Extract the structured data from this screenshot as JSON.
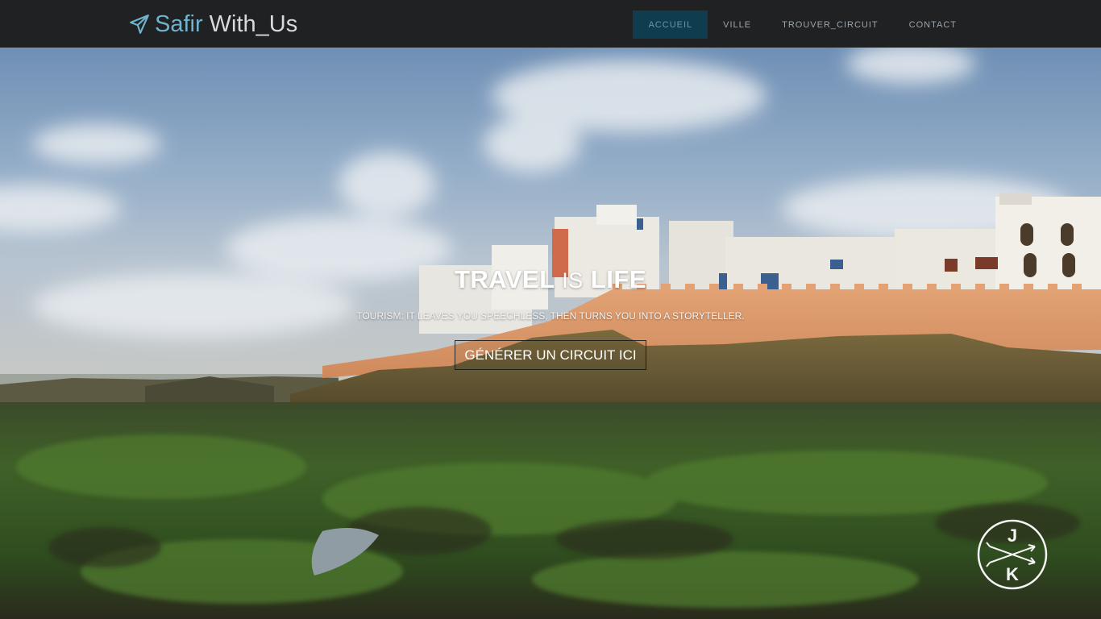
{
  "brand": {
    "word1": "Safir",
    "word2": "With_Us",
    "icon": "paper-plane-icon"
  },
  "nav": [
    {
      "label": "ACCUEIL",
      "active": true
    },
    {
      "label": "VILLE",
      "active": false
    },
    {
      "label": "TROUVER_CIRCUIT",
      "active": false
    },
    {
      "label": "CONTACT",
      "active": false
    }
  ],
  "hero": {
    "title_part1": "TRAVEL",
    "title_part2": "IS",
    "title_part3": "LIFE",
    "subtitle": "TOURISM: IT LEAVES YOU SPEECHLESS, THEN TURNS YOU INTO A STORYTELLER.",
    "cta_label": "GÉNÉRER UN CIRCUIT ICI"
  },
  "watermark": {
    "letter_top": "J",
    "letter_bottom": "K"
  },
  "colors": {
    "navbar_bg": "#202122",
    "accent": "#6fb3cf",
    "active_nav_bg": "#0f3d4f"
  }
}
